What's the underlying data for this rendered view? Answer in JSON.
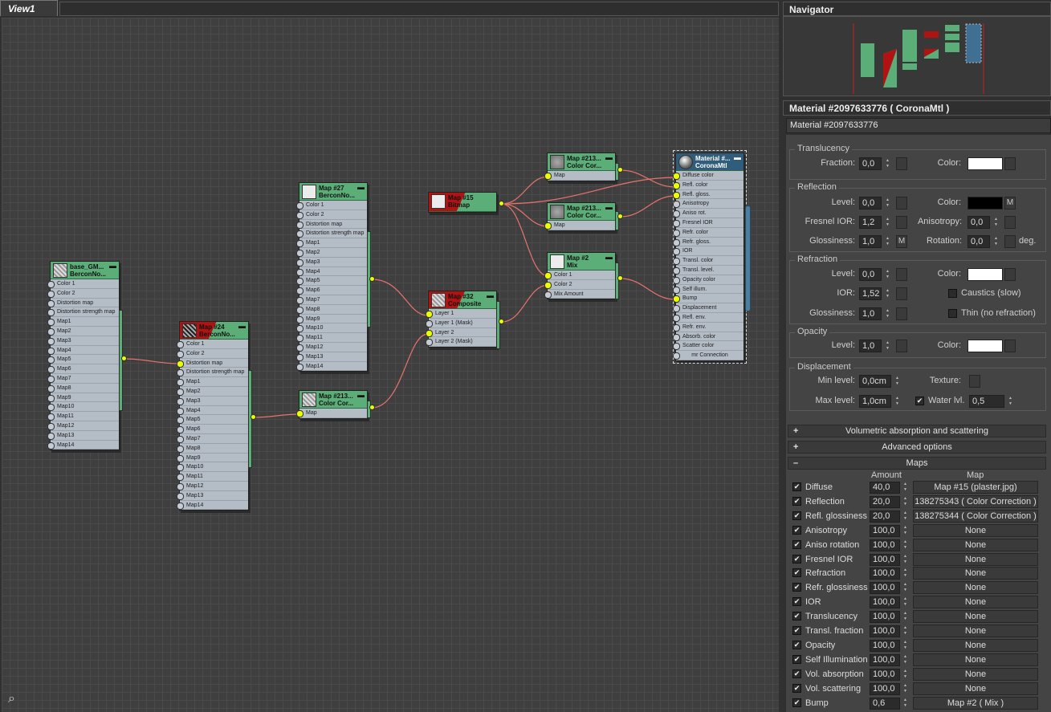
{
  "view": {
    "tab_label": "View1"
  },
  "nodes": {
    "base": {
      "title1": "base_GM...",
      "title2": "BerconNo...",
      "slots": [
        "Color 1",
        "Color 2",
        "Distortion map",
        "Distortion strength map",
        "Map1",
        "Map2",
        "Map3",
        "Map4",
        "Map5",
        "Map6",
        "Map7",
        "Map8",
        "Map9",
        "Map10",
        "Map11",
        "Map12",
        "Map13",
        "Map14"
      ]
    },
    "map24": {
      "title1": "Map #24",
      "title2": "BerconNo...",
      "slots": [
        "Color 1",
        "Color 2",
        "Distortion map",
        "Distortion strength map",
        "Map1",
        "Map2",
        "Map3",
        "Map4",
        "Map5",
        "Map6",
        "Map7",
        "Map8",
        "Map9",
        "Map10",
        "Map11",
        "Map12",
        "Map13",
        "Map14"
      ]
    },
    "map27": {
      "title1": "Map #27",
      "title2": "BerconNo...",
      "slots": [
        "Color 1",
        "Color 2",
        "Distortion map",
        "Distortion strength map",
        "Map1",
        "Map2",
        "Map3",
        "Map4",
        "Map5",
        "Map6",
        "Map7",
        "Map8",
        "Map9",
        "Map10",
        "Map11",
        "Map12",
        "Map13",
        "Map14"
      ]
    },
    "cc_low": {
      "title1": "Map #213...",
      "title2": "Color Cor...",
      "slots": [
        "Map"
      ]
    },
    "map15": {
      "title1": "Map #15",
      "title2": "Bitmap",
      "slots": []
    },
    "map32": {
      "title1": "Map #32",
      "title2": "Composite",
      "slots": [
        "Layer 1",
        "Layer 1 (Mask)",
        "Layer 2",
        "Layer 2 (Mask)"
      ]
    },
    "cc_top": {
      "title1": "Map #213...",
      "title2": "Color Cor...",
      "slots": [
        "Map"
      ]
    },
    "cc_mid": {
      "title1": "Map #213...",
      "title2": "Color Cor...",
      "slots": [
        "Map"
      ]
    },
    "map2": {
      "title1": "Map #2",
      "title2": "Mix",
      "slots": [
        "Color 1",
        "Color 2",
        "Mix Amount"
      ]
    },
    "material": {
      "title1": "Material #...",
      "title2": "CoronaMtl",
      "slots": [
        "Diffuse color",
        "Refl. color",
        "Refl. gloss.",
        "Anisotropy",
        "Aniso rot.",
        "Fresnel IOR",
        "Refr. color",
        "Refr. gloss.",
        "IOR",
        "Transl. color",
        "Transl. level.",
        "Opacity color",
        "Self illum.",
        "Bump",
        "Displacement",
        "Refl. env.",
        "Refr. env.",
        "Absorb. color",
        "Scatter color"
      ],
      "footer": "mr Connection"
    }
  },
  "navigator": {
    "title": "Navigator"
  },
  "material_panel": {
    "title": "Material #2097633776  ( CoronaMtl )",
    "name": "Material #2097633776",
    "translucency": {
      "label": "Translucency",
      "fraction_label": "Fraction:",
      "fraction": "0,0",
      "color_label": "Color:"
    },
    "reflection": {
      "label": "Reflection",
      "level_label": "Level:",
      "level": "0,0",
      "color_label": "Color:",
      "m": "M",
      "fresnel_label": "Fresnel IOR:",
      "fresnel": "1,2",
      "aniso_label": "Anisotropy:",
      "aniso": "0,0",
      "gloss_label": "Glossiness:",
      "gloss": "1,0",
      "gloss_m": "M",
      "rot_label": "Rotation:",
      "rot": "0,0",
      "deg": "deg."
    },
    "refraction": {
      "label": "Refraction",
      "level_label": "Level:",
      "level": "0,0",
      "color_label": "Color:",
      "ior_label": "IOR:",
      "ior": "1,52",
      "caustics": "Caustics (slow)",
      "gloss_label": "Glossiness:",
      "gloss": "1,0",
      "thin": "Thin (no refraction)"
    },
    "opacity": {
      "label": "Opacity",
      "level_label": "Level:",
      "level": "1,0",
      "color_label": "Color:"
    },
    "displacement": {
      "label": "Displacement",
      "min_label": "Min level:",
      "min": "0,0cm",
      "texture_label": "Texture:",
      "max_label": "Max level:",
      "max": "1,0cm",
      "water_label": "Water lvl.",
      "water": "0,5"
    },
    "volumetric": "Volumetric absorption and scattering",
    "advanced": "Advanced options",
    "maps_title": "Maps",
    "amount_header": "Amount",
    "map_header": "Map",
    "maps": [
      {
        "name": "Diffuse",
        "amount": "40,0",
        "map": "Map #15 (plaster.jpg)"
      },
      {
        "name": "Reflection",
        "amount": "20,0",
        "map": "138275343  ( Color Correction )"
      },
      {
        "name": "Refl. glossiness",
        "amount": "20,0",
        "map": "138275344  ( Color Correction )"
      },
      {
        "name": "Anisotropy",
        "amount": "100,0",
        "map": "None"
      },
      {
        "name": "Aniso rotation",
        "amount": "100,0",
        "map": "None"
      },
      {
        "name": "Fresnel IOR",
        "amount": "100,0",
        "map": "None"
      },
      {
        "name": "Refraction",
        "amount": "100,0",
        "map": "None"
      },
      {
        "name": "Refr. glossiness",
        "amount": "100,0",
        "map": "None"
      },
      {
        "name": "IOR",
        "amount": "100,0",
        "map": "None"
      },
      {
        "name": "Translucency",
        "amount": "100,0",
        "map": "None"
      },
      {
        "name": "Transl. fraction",
        "amount": "100,0",
        "map": "None"
      },
      {
        "name": "Opacity",
        "amount": "100,0",
        "map": "None"
      },
      {
        "name": "Self Illumination",
        "amount": "100,0",
        "map": "None"
      },
      {
        "name": "Vol. absorption",
        "amount": "100,0",
        "map": "None"
      },
      {
        "name": "Vol. scattering",
        "amount": "100,0",
        "map": "None"
      },
      {
        "name": "Bump",
        "amount": "0,6",
        "map": "Map #2  ( Mix )"
      }
    ]
  },
  "colors": {
    "node_green": "#5cae78",
    "node_red": "#b11212",
    "wire": "#e8736d",
    "socket_active": "#e9ff00",
    "material_header": "#2f5d7b"
  }
}
